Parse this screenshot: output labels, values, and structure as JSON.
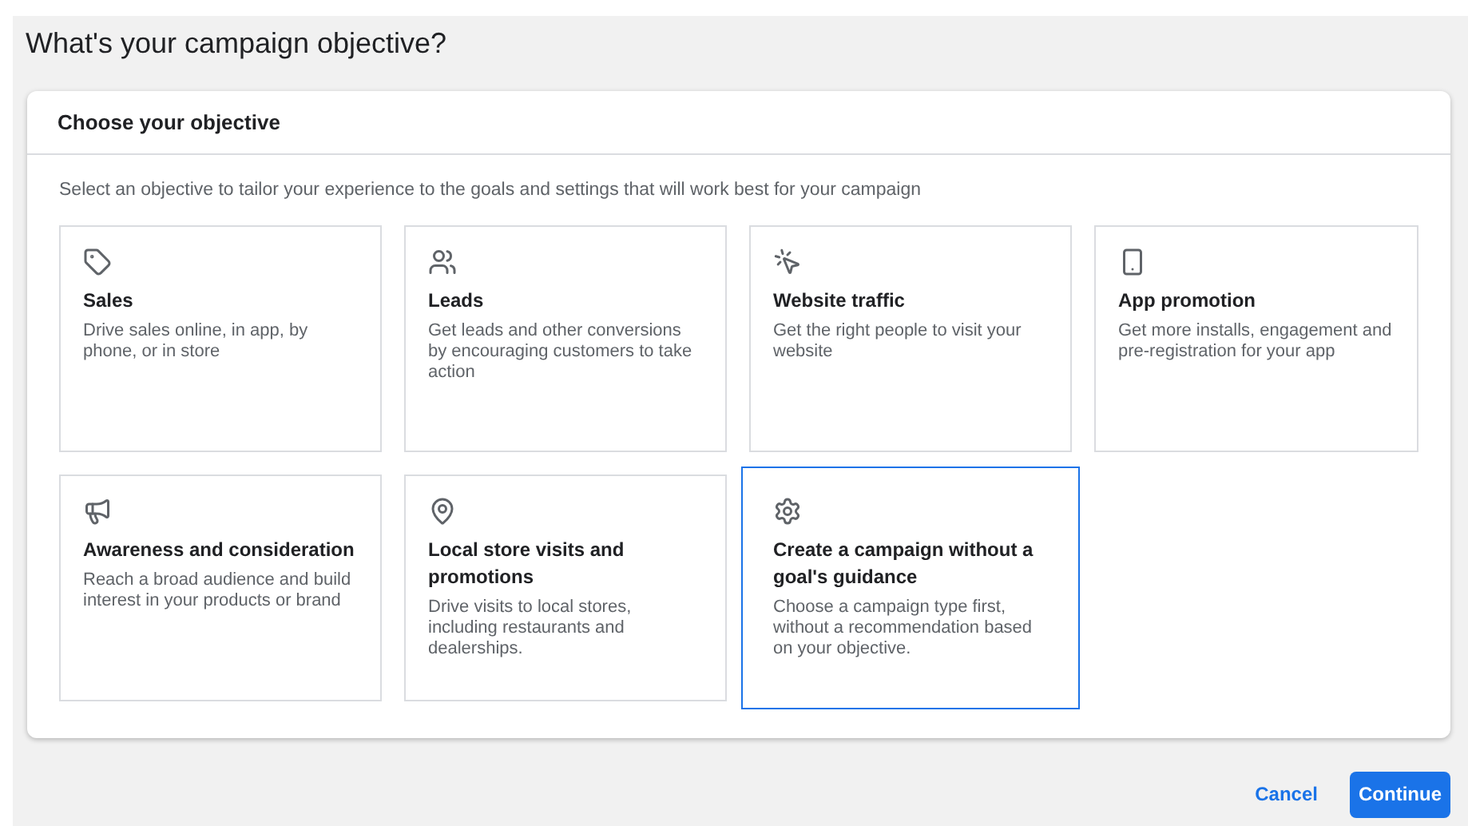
{
  "page_title": "What's your campaign objective?",
  "panel": {
    "title": "Choose your objective",
    "subtitle": "Select an objective to tailor your experience to the goals and settings that will work best for your campaign"
  },
  "objectives": [
    {
      "kind": "tag",
      "title": "Sales",
      "description": "Drive sales online, in app, by phone, or in store",
      "selected": false
    },
    {
      "kind": "people",
      "title": "Leads",
      "description": "Get leads and other conversions by encouraging customers to take action",
      "selected": false
    },
    {
      "kind": "cursor",
      "title": "Website traffic",
      "description": "Get the right people to visit your website",
      "selected": false
    },
    {
      "kind": "phone",
      "title": "App promotion",
      "description": "Get more installs, engagement and pre-registration for your app",
      "selected": false
    },
    {
      "kind": "megaphone",
      "title": "Awareness and consideration",
      "description": "Reach a broad audience and build interest in your products or brand",
      "selected": false
    },
    {
      "kind": "pin",
      "title": "Local store visits and promotions",
      "description": "Drive visits to local stores, including restaurants and dealerships.",
      "selected": false
    },
    {
      "kind": "gear",
      "title": "Create a campaign without a goal's guidance",
      "description": "Choose a campaign type first, without a recommendation based on your objective.",
      "selected": true
    }
  ],
  "buttons": {
    "cancel": "Cancel",
    "continue": "Continue"
  }
}
